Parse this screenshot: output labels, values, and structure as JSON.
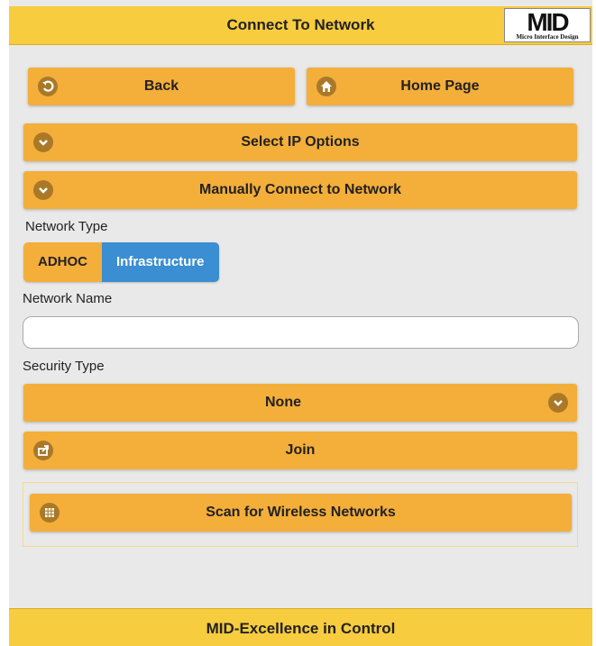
{
  "header": {
    "title": "Connect To Network",
    "logo_text": "MID",
    "logo_sub": "Micro Interface Design"
  },
  "nav": {
    "back_label": "Back",
    "home_label": "Home Page"
  },
  "sections": {
    "ip_options_label": "Select IP Options",
    "manual_connect_label": "Manually Connect to Network"
  },
  "form": {
    "network_type_label": "Network Type",
    "network_type_options": [
      "ADHOC",
      "Infrastructure"
    ],
    "network_type_selected": "Infrastructure",
    "network_name_label": "Network Name",
    "network_name_value": "",
    "network_name_placeholder": "",
    "security_type_label": "Security Type",
    "security_type_selected": "None",
    "join_label": "Join"
  },
  "scan": {
    "scan_label": "Scan for Wireless Networks"
  },
  "footer": {
    "text": "MID-Excellence in Control"
  },
  "colors": {
    "header_bg": "#f7cc3f",
    "button_bg": "#f4ae3a",
    "selected_bg": "#3a8ed1",
    "page_bg": "#e9e9e9"
  },
  "icons": {
    "back": "back-arrow-icon",
    "home": "home-icon",
    "ip_options": "chevron-down-icon",
    "manual_connect": "chevron-down-icon",
    "security": "chevron-down-icon",
    "join": "share-icon",
    "scan": "grid-icon"
  }
}
